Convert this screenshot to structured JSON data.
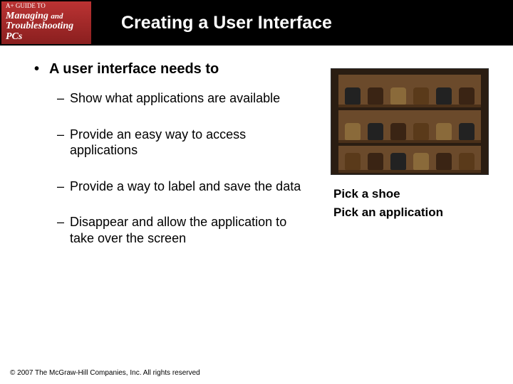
{
  "logo": {
    "top": "A+ GUIDE TO",
    "line1a": "Managing",
    "line1b": "and",
    "line2": "Troubleshooting PCs"
  },
  "title": "Creating a User Interface",
  "main_bullet": "A user interface needs to",
  "subs": [
    "Show what applications are available",
    "Provide an easy way to access applications",
    "Provide a way to label and save the data",
    "Disappear and allow the application to take over the screen"
  ],
  "caption": {
    "line1": "Pick a shoe",
    "line2": "Pick an application"
  },
  "footer": "© 2007 The McGraw-Hill Companies, Inc. All rights reserved"
}
